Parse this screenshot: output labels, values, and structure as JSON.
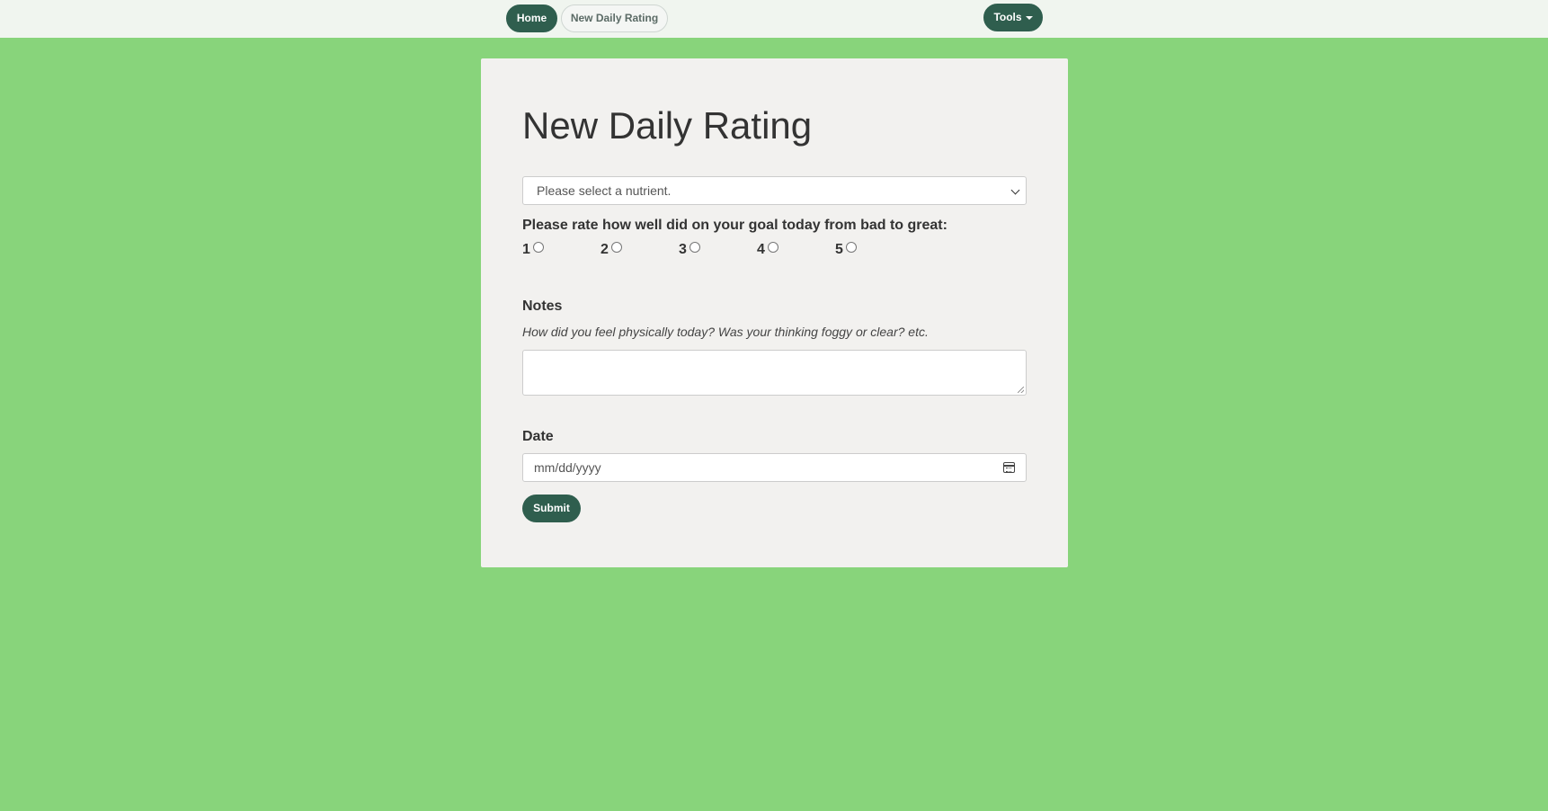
{
  "nav": {
    "home_label": "Home",
    "new_rating_label": "New Daily Rating",
    "tools_label": "Tools"
  },
  "form": {
    "title": "New Daily Rating",
    "nutrient_select": {
      "selected": "Please select a nutrient."
    },
    "rating": {
      "label": "Please rate how well did on your goal today from bad to great:",
      "options": [
        "1",
        "2",
        "3",
        "4",
        "5"
      ],
      "selected": null
    },
    "notes": {
      "label": "Notes",
      "help": "How did you feel physically today? Was your thinking foggy or clear? etc.",
      "value": ""
    },
    "date": {
      "label": "Date",
      "placeholder": "mm/dd/yyyy"
    },
    "submit_label": "Submit"
  },
  "colors": {
    "background": "#88d47b",
    "navbar": "#f0f5ef",
    "card": "#f2f1ef",
    "primary": "#2f5e4e"
  },
  "icons": {
    "select_arrow": "chevron-down-icon",
    "date_picker": "calendar-icon",
    "tools_dropdown": "caret-down-icon"
  }
}
